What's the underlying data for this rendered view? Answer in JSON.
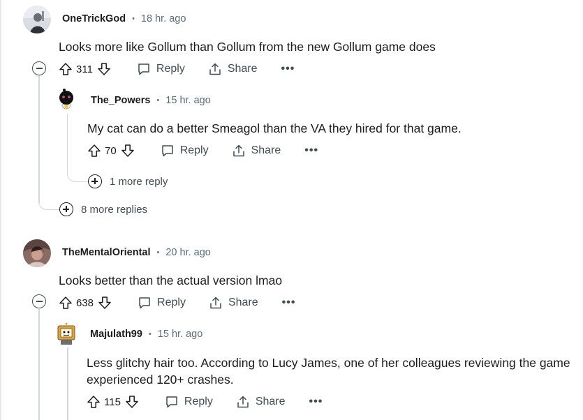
{
  "comments": [
    {
      "username": "OneTrickGod",
      "time": "18 hr. ago",
      "body": "Looks more like Gollum than Gollum from the new Gollum game does",
      "votes": "311",
      "reply_label": "Reply",
      "share_label": "Share",
      "more_replies": "8 more replies",
      "reply": {
        "username": "The_Powers",
        "time": "15 hr. ago",
        "body": "My cat can do a better Smeagol than the VA they hired for that game.",
        "votes": "70",
        "reply_label": "Reply",
        "share_label": "Share",
        "more_replies": "1 more reply"
      }
    },
    {
      "username": "TheMentalOriental",
      "time": "20 hr. ago",
      "body": "Looks better than the actual version lmao",
      "votes": "638",
      "reply_label": "Reply",
      "share_label": "Share",
      "reply": {
        "username": "Majulath99",
        "time": "15 hr. ago",
        "body_line1": "Less glitchy hair too. According to Lucy James, one of her colleagues reviewing the game",
        "body_line2": "experienced 120+ crashes.",
        "votes": "115",
        "reply_label": "Reply",
        "share_label": "Share"
      }
    }
  ],
  "separator": "•",
  "overflow": "•••",
  "icons": [
    "upvote-icon",
    "downvote-icon",
    "reply-bubble-icon",
    "share-icon",
    "collapse-icon",
    "expand-icon",
    "more-options-icon"
  ]
}
